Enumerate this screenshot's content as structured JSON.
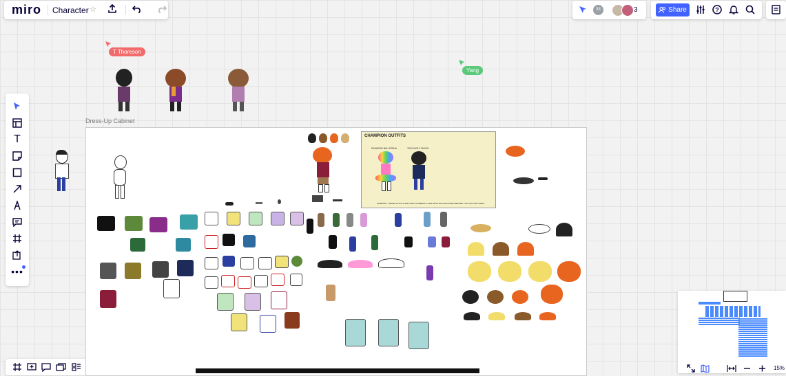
{
  "app": {
    "logo": "miro",
    "board_title": "Character"
  },
  "collab": {
    "count": "3",
    "avatar_count": "33"
  },
  "share": {
    "label": "Share"
  },
  "cursors": [
    {
      "name": "T Thoreson",
      "color": "#f26b6b"
    },
    {
      "name": "Yang",
      "color": "#5ac97a"
    }
  ],
  "frame": {
    "title": "Dress-Up Cabinet"
  },
  "champion": {
    "title": "CHAMPION OUTFITS",
    "left_label": "RAINBOW BALLERINA",
    "right_label": "TWO WOLF MOON",
    "warning": "WARNING: THESE OUTFITS ARE VERY POWERFUL AND MUST BE UNLOCKED BEFORE YOU CAN USE THEM"
  },
  "zoom": {
    "value": "15%"
  },
  "toolbar": {
    "tools": [
      "select-icon",
      "templates-icon",
      "text-icon",
      "sticky-note-icon",
      "shape-icon",
      "arrow-icon",
      "pen-icon",
      "comment-icon",
      "frame-icon",
      "upload-icon",
      "more-icon"
    ]
  },
  "colors": {
    "accent": "#4262ff",
    "hair_orange": "#e8651f",
    "hair_yellow": "#f2dc6a",
    "black": "#1a1a1a"
  }
}
